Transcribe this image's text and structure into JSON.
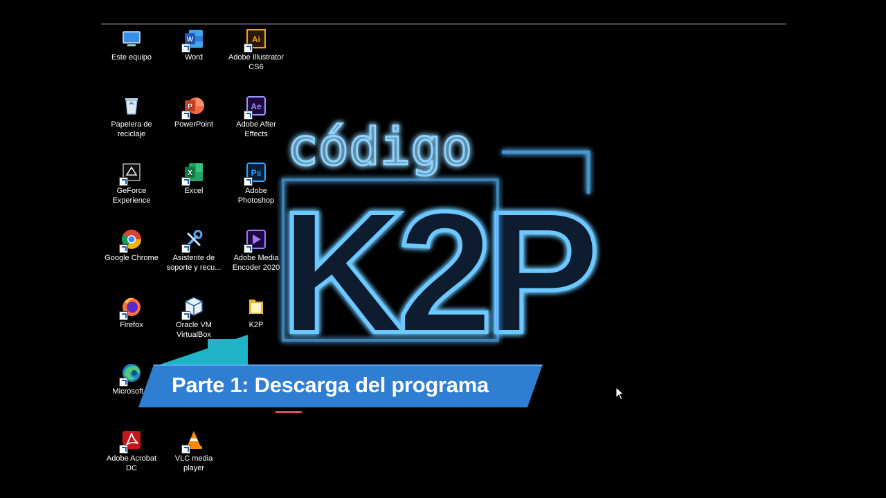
{
  "desktop": {
    "icons": [
      {
        "label": "Este equipo",
        "icon": "computer-icon"
      },
      {
        "label": "Word",
        "icon": "word-icon"
      },
      {
        "label": "Adobe Illustrator\nCS6",
        "icon": "illustrator-icon"
      },
      {
        "label": "Papelera de\nreciclaje",
        "icon": "recycle-bin-icon"
      },
      {
        "label": "PowerPoint",
        "icon": "powerpoint-icon"
      },
      {
        "label": "Adobe After\nEffects",
        "icon": "after-effects-icon"
      },
      {
        "label": "GeForce\nExperience",
        "icon": "geforce-icon"
      },
      {
        "label": "Excel",
        "icon": "excel-icon"
      },
      {
        "label": "Adobe\nPhotoshop",
        "icon": "photoshop-icon"
      },
      {
        "label": "Google Chrome",
        "icon": "chrome-icon"
      },
      {
        "label": "Asistente de\nsoporte y recu...",
        "icon": "support-assistant-icon"
      },
      {
        "label": "Adobe Media\nEncoder 2020",
        "icon": "media-encoder-icon"
      },
      {
        "label": "Firefox",
        "icon": "firefox-icon"
      },
      {
        "label": "Oracle VM\nVirtualBox",
        "icon": "virtualbox-icon"
      },
      {
        "label": "K2P",
        "icon": "folder-icon"
      },
      {
        "label": "Microsoft E",
        "icon": "edge-icon"
      },
      {
        "label": "Adobe Acrobat\nDC",
        "icon": "acrobat-icon"
      },
      {
        "label": "VLC media\nplayer",
        "icon": "vlc-icon"
      }
    ]
  },
  "logo": {
    "small_text": "código",
    "main_text": "K2P",
    "glow_color": "#4fb8ff"
  },
  "banner": {
    "title": "Parte 1: Descarga del programa",
    "color": "#2f7ed1",
    "accent_color": "#1fb5c9"
  }
}
